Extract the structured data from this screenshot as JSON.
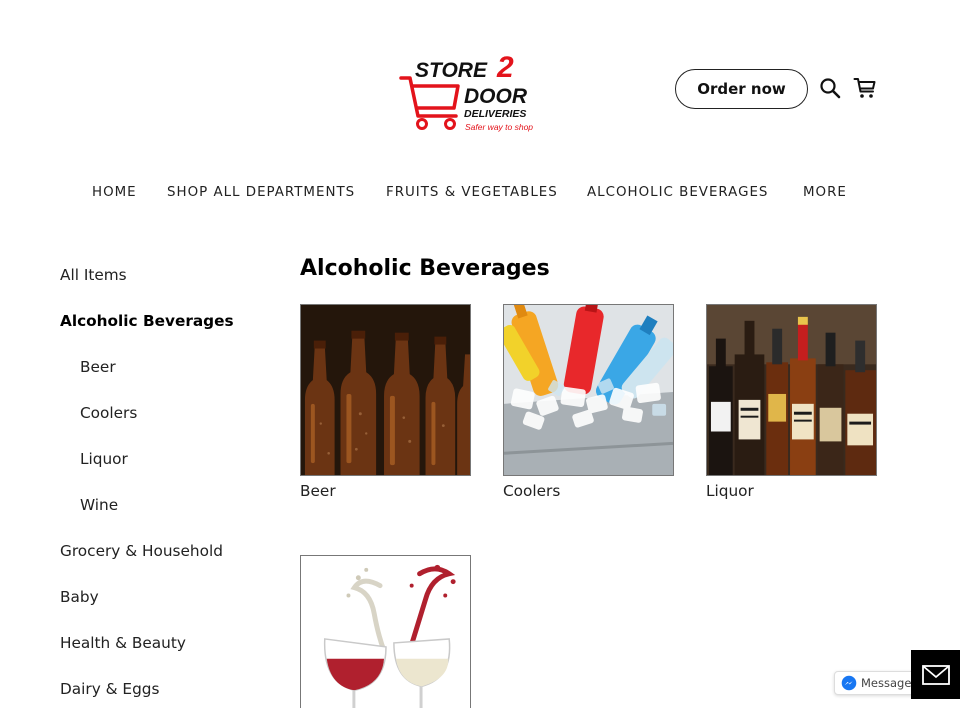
{
  "header": {
    "logo": {
      "word1": "STORE",
      "word2": "DOOR",
      "number": "2",
      "word3": "DELIVERIES",
      "tagline": "Safer way to shop"
    },
    "order_button": "Order now",
    "icons": [
      "search-icon",
      "cart-icon"
    ],
    "brand_color": "#e3131b"
  },
  "nav": {
    "items": [
      "HOME",
      "SHOP ALL DEPARTMENTS",
      "FRUITS & VEGETABLES",
      "ALCOHOLIC BEVERAGES",
      "MORE"
    ]
  },
  "sidebar": {
    "items": [
      "All Items",
      "Alcoholic Beverages",
      "Beer",
      "Coolers",
      "Liquor",
      "Wine",
      "Grocery & Household",
      "Baby",
      "Health & Beauty",
      "Dairy & Eggs"
    ],
    "active": "Alcoholic Beverages"
  },
  "main": {
    "title": "Alcoholic Beverages",
    "categories": [
      "Beer",
      "Coolers",
      "Liquor"
    ]
  },
  "widgets": {
    "messenger_label": "Message Us",
    "icons": [
      "messenger-icon",
      "mail-icon"
    ]
  }
}
